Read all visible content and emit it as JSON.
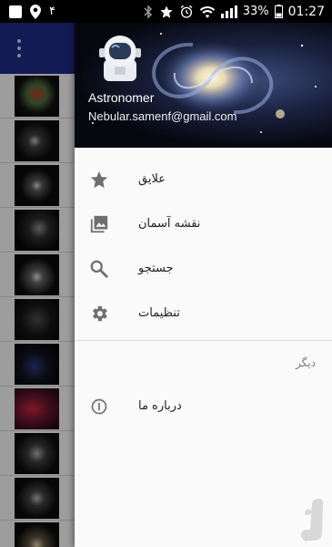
{
  "status_bar": {
    "notification_count": "۴",
    "battery": "33%",
    "time": "01:27"
  },
  "user": {
    "name": "Astronomer",
    "email": "Nebular.samenf@gmail.com"
  },
  "menu": {
    "items": [
      {
        "label": "علایق",
        "icon": "star-icon"
      },
      {
        "label": "نقشه آسمان",
        "icon": "photo-icon"
      },
      {
        "label": "جستجو",
        "icon": "search-icon"
      },
      {
        "label": "تنظیمات",
        "icon": "gear-icon"
      }
    ],
    "section_other": "دیگر",
    "about_label": "درباره ما"
  },
  "colors": {
    "toolbar": "#1c2a80",
    "icon": "#6f6f6f",
    "drawer_bg": "#fafafa"
  }
}
